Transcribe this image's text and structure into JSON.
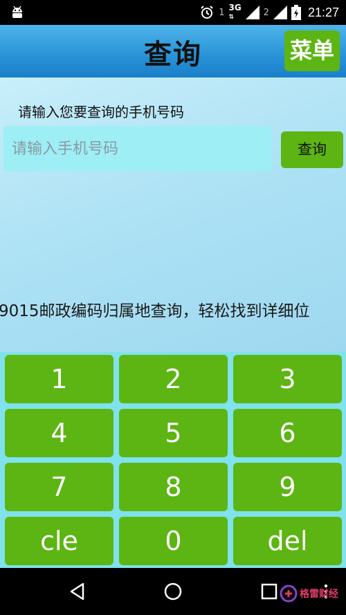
{
  "status_bar": {
    "sim1_label": "1",
    "network_type": "3G",
    "sim2_label": "2",
    "time": "21:27",
    "icons": [
      "android-icon",
      "alarm-icon",
      "signal-icon",
      "battery-icon"
    ]
  },
  "app_bar": {
    "title": "查询",
    "menu_label": "菜单"
  },
  "content": {
    "prompt_label": "请输入您要查询的手机号码",
    "input_placeholder": "请输入手机号码",
    "input_value": "",
    "query_label": "查询",
    "marquee_text": "9015邮政编码归属地查询，轻松找到详细位"
  },
  "keypad": {
    "keys": [
      "1",
      "2",
      "3",
      "4",
      "5",
      "6",
      "7",
      "8",
      "9",
      "cle",
      "0",
      "del"
    ]
  },
  "nav_bar": {
    "icons": [
      "back-icon",
      "home-icon",
      "recents-icon",
      "overflow-icon"
    ]
  },
  "watermark": {
    "text": "格雷财经"
  },
  "colors": {
    "accent_green": "#5cb512",
    "appbar_blue": "#2a95d8",
    "keypad_bg": "#7fe2ec",
    "input_bg": "#9eeef5"
  }
}
